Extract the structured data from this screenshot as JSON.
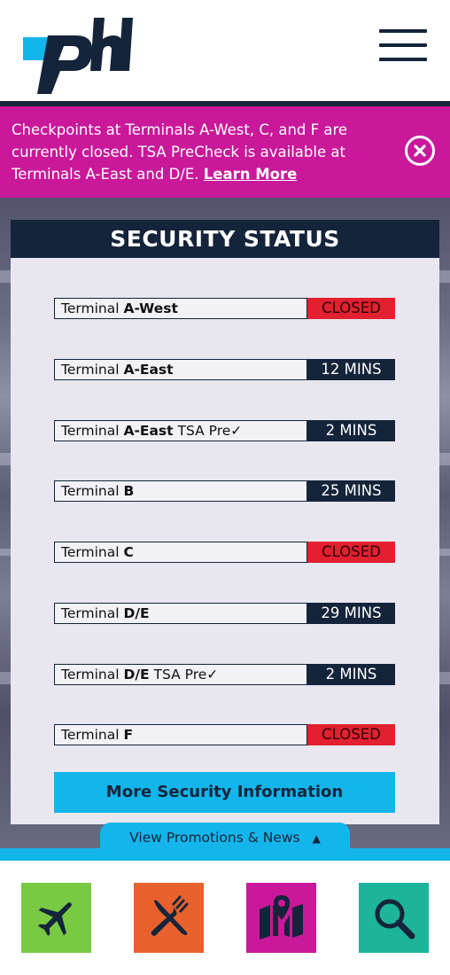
{
  "header": {
    "logo_text": "phl",
    "menu_icon": "hamburger-menu-icon"
  },
  "alert": {
    "message": "Checkpoints at Terminals A-West, C, and F are currently closed. TSA PreCheck is available at Terminals A-East and D/E.",
    "link_text": "Learn More",
    "close_icon": "close-icon"
  },
  "security": {
    "title": "SECURITY STATUS",
    "rows": [
      {
        "prefix": "Terminal",
        "terminal": "A-West",
        "suffix": "",
        "status": "CLOSED",
        "closed": true
      },
      {
        "prefix": "Terminal",
        "terminal": "A-East",
        "suffix": "",
        "status": "12 MINS",
        "closed": false
      },
      {
        "prefix": "Terminal",
        "terminal": "A-East",
        "suffix": "TSA Pre✓",
        "status": "2 MINS",
        "closed": false
      },
      {
        "prefix": "Terminal",
        "terminal": "B",
        "suffix": "",
        "status": "25 MINS",
        "closed": false
      },
      {
        "prefix": "Terminal",
        "terminal": "C",
        "suffix": "",
        "status": "CLOSED",
        "closed": true
      },
      {
        "prefix": "Terminal",
        "terminal": "D/E",
        "suffix": "",
        "status": "29 MINS",
        "closed": false
      },
      {
        "prefix": "Terminal",
        "terminal": "D/E",
        "suffix": "TSA Pre✓",
        "status": "2 MINS",
        "closed": false
      },
      {
        "prefix": "Terminal",
        "terminal": "F",
        "suffix": "",
        "status": "CLOSED",
        "closed": true
      }
    ],
    "more_button": "More Security Information"
  },
  "promo": {
    "label": "View Promotions & News",
    "arrow": "▲"
  },
  "bottom_nav": [
    {
      "name": "flights",
      "icon": "airplane-icon",
      "color": "#7ac943"
    },
    {
      "name": "dining",
      "icon": "fork-knife-icon",
      "color": "#e8612c"
    },
    {
      "name": "maps",
      "icon": "map-pin-icon",
      "color": "#c9189a"
    },
    {
      "name": "search",
      "icon": "search-icon",
      "color": "#1cb59a"
    }
  ],
  "colors": {
    "navy": "#14243a",
    "magenta": "#c9189a",
    "cyan": "#13b5ea",
    "closed_red": "#e2202f"
  }
}
